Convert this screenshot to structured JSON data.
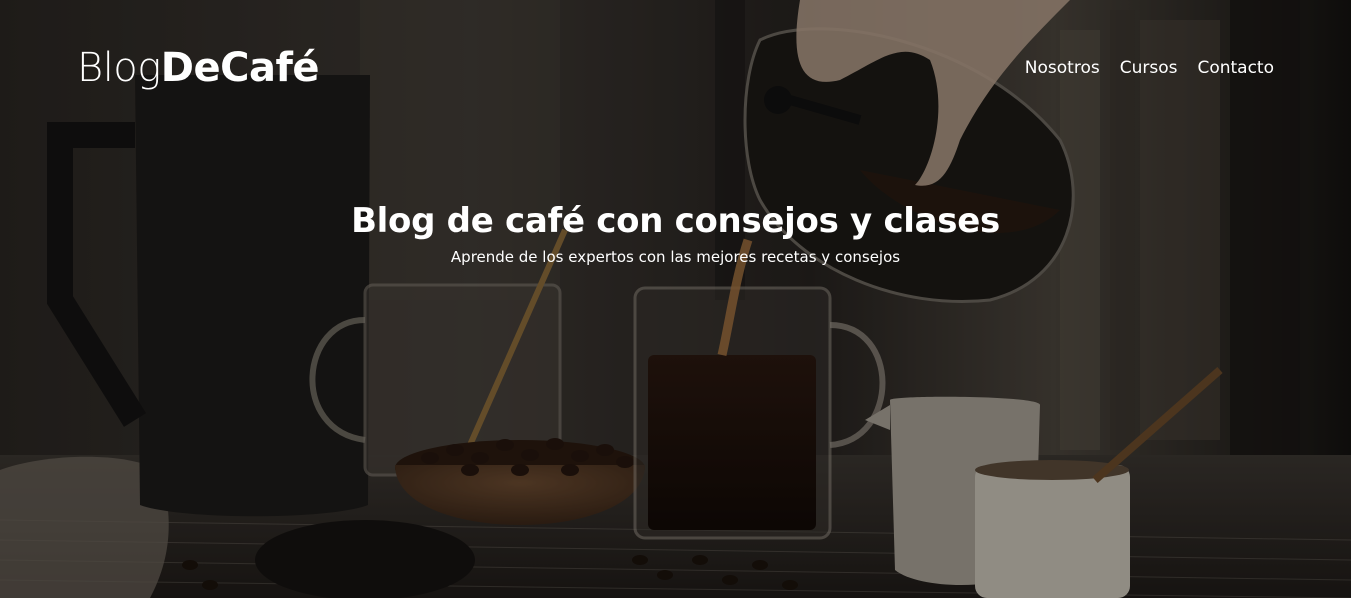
{
  "header": {
    "logo_light": "Blog",
    "logo_bold": "DeCafé",
    "nav": [
      {
        "label": "Nosotros"
      },
      {
        "label": "Cursos"
      },
      {
        "label": "Contacto"
      }
    ]
  },
  "hero": {
    "title": "Blog de café con consejos y clases",
    "subtitle": "Aprende de los expertos con las mejores recetas y consejos",
    "background_image": "coffee-pour-photo",
    "overlay_color": "#000000"
  }
}
